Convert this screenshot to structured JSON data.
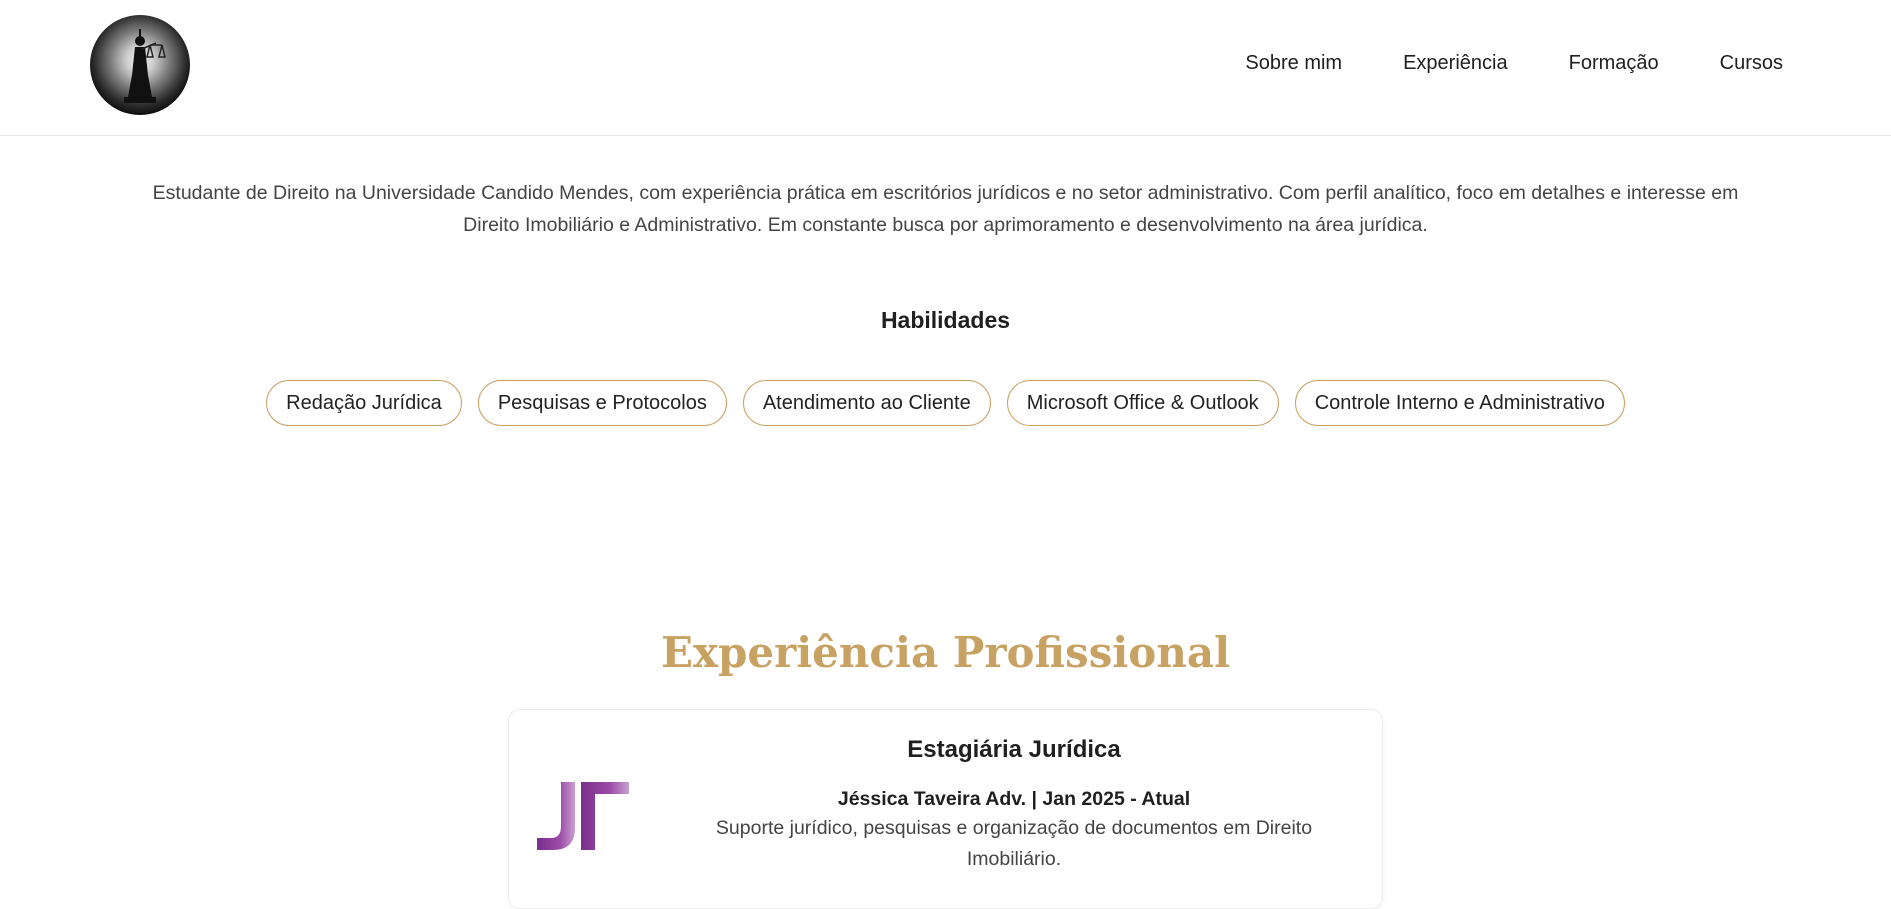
{
  "header": {
    "logo_icon": "lady-justice-icon",
    "nav": [
      {
        "label": "Sobre mim"
      },
      {
        "label": "Experiência"
      },
      {
        "label": "Formação"
      },
      {
        "label": "Cursos"
      }
    ]
  },
  "about": {
    "text": "Estudante de Direito na Universidade Candido Mendes, com experiência prática em escritórios jurídicos e no setor administrativo. Com perfil analítico, foco em detalhes e interesse em Direito Imobiliário e Administrativo. Em constante busca por aprimoramento e desenvolvimento na área jurídica."
  },
  "skills": {
    "title": "Habilidades",
    "items": [
      "Redação Jurídica",
      "Pesquisas e Protocolos",
      "Atendimento ao Cliente",
      "Microsoft Office & Outlook",
      "Controle Interno e Administrativo"
    ]
  },
  "experience": {
    "title": "Experiência Profissional",
    "items": [
      {
        "role": "Estagiária Jurídica",
        "company": "Jéssica Taveira Adv. | Jan 2025 - Atual",
        "description": "Suporte jurídico, pesquisas e organização de documentos em Direito Imobiliário.",
        "logo_icon": "jt-monogram-logo"
      }
    ]
  },
  "colors": {
    "accent_gold": "#c8a263",
    "pill_border": "#c9a063",
    "logo_purple": "#8e3f9a"
  }
}
